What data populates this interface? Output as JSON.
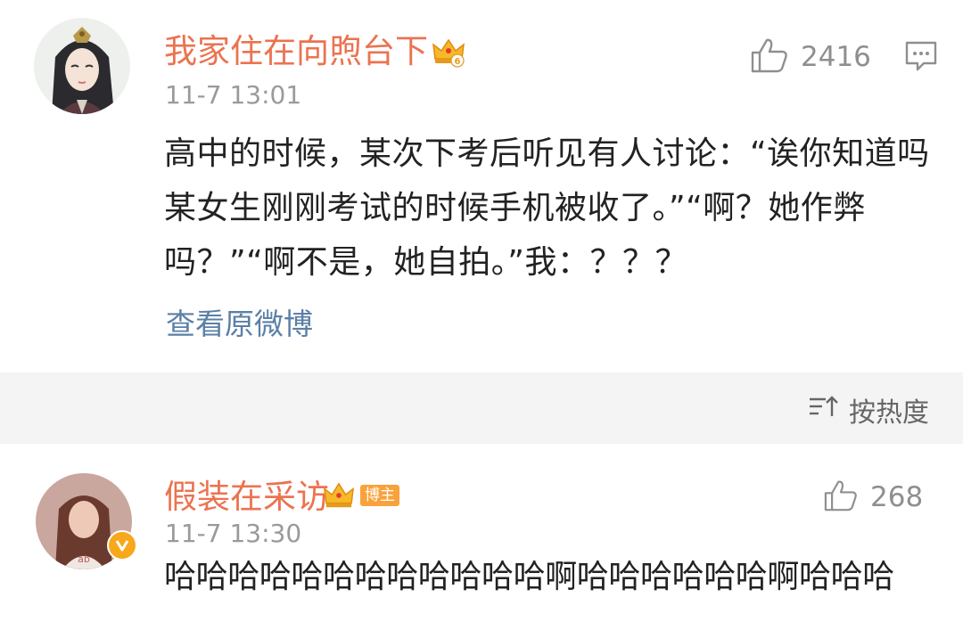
{
  "post": {
    "username": "我家住在向煦台下",
    "timestamp": "11-7 13:01",
    "likes": "2416",
    "text": "高中的时候，某次下考后听见有人讨论：“诶你知道吗某女生刚刚考试的时候手机被收了。”“啊？她作弊吗？”“啊不是，她自拍。”我：？？？",
    "view_original": "查看原微博",
    "member_level": "6"
  },
  "sort": {
    "label": "按热度"
  },
  "reply": {
    "username": "假装在采访",
    "badge": "博主",
    "timestamp": "11-7 13:30",
    "likes": "268",
    "text": "哈哈哈哈哈哈哈哈哈哈哈哈啊哈哈哈哈哈哈啊哈哈哈"
  },
  "icons": {
    "like": "thumbs-up-icon",
    "comment": "comment-icon",
    "sort": "sort-icon",
    "crown": "crown-icon",
    "verified": "verified-icon"
  },
  "colors": {
    "username": "#eb7350",
    "link": "#5b7fa6",
    "meta": "#9a9a9a",
    "badge": "#f9a23b",
    "band": "#f4f4f4"
  }
}
